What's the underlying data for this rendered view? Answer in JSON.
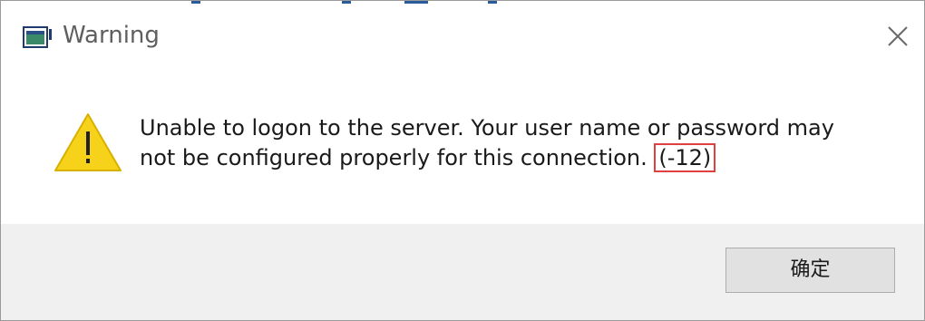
{
  "window": {
    "title": "Warning",
    "app_icon": "window-app-icon",
    "close_icon": "close-icon"
  },
  "message": {
    "icon": "warning-icon",
    "line1": "Unable to logon to the server. Your user name or password may",
    "line2_text": "not be configured properly for this connection. ",
    "error_code": "(-12)",
    "error_code_highlight_color": "#e04040"
  },
  "buttons": {
    "ok_label": "确定"
  },
  "colors": {
    "footer_bg": "#f0f0f0",
    "warning_yellow": "#f7d21a"
  }
}
